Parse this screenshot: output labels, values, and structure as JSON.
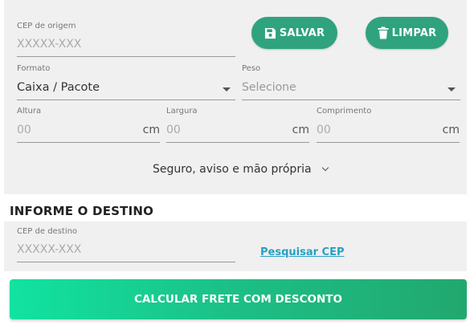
{
  "origin": {
    "label": "CEP de origem",
    "placeholder": "XXXXX-XXX"
  },
  "buttons": {
    "save_label": "SALVAR",
    "clear_label": "LIMPAR",
    "save_icon": "floppy-disk-icon",
    "clear_icon": "trash-icon"
  },
  "format": {
    "label": "Formato",
    "value": "Caixa / Pacote"
  },
  "weight": {
    "label": "Peso",
    "value": "Selecione"
  },
  "dimensions": {
    "height_label": "Altura",
    "width_label": "Largura",
    "length_label": "Comprimento",
    "height_value": "00",
    "width_value": "00",
    "length_value": "00",
    "unit": "cm"
  },
  "extras_toggle": "Seguro, aviso e mão própria",
  "destination": {
    "section_title": "INFORME O DESTINO",
    "label": "CEP de destino",
    "placeholder": "XXXXX-XXX",
    "search_link": "Pesquisar CEP"
  },
  "cta_label": "CALCULAR FRETE COM DESCONTO",
  "colors": {
    "panel_bg": "#f0f0f0",
    "button_green": "#2fa37d",
    "cta_gradient_start": "#11e3a0",
    "cta_gradient_end": "#21a86f",
    "link_blue": "#2a9fc4"
  }
}
